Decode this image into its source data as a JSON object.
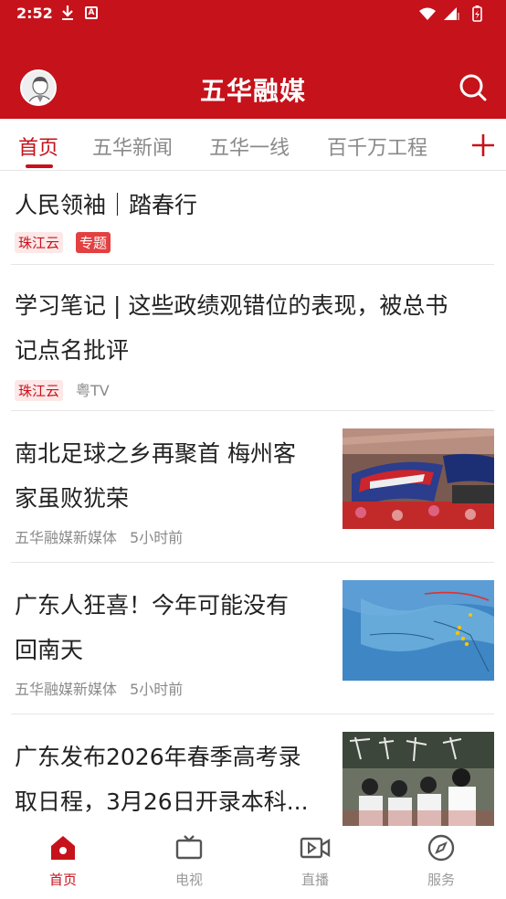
{
  "status_bar": {
    "time": "2:52",
    "download_icon": "download-icon",
    "accessibility_icon": "a-badge-icon"
  },
  "header": {
    "title": "五华融媒",
    "avatar_icon": "user-avatar-icon",
    "search_icon": "search-icon",
    "background": "#c6121b"
  },
  "tabs": [
    {
      "label": "首页",
      "active": true
    },
    {
      "label": "五华新闻"
    },
    {
      "label": "五华一线"
    },
    {
      "label": "百千万工程"
    }
  ],
  "tab_add_icon": "plus-icon",
  "feed": [
    {
      "title": "人民领袖｜踏春行",
      "tags": [
        "珠江云",
        "专题"
      ]
    },
    {
      "title_line1": "学习笔记 | 这些政绩观错位的表现，被总书",
      "title_line2": "记点名批评",
      "tag": "珠江云",
      "source": "粤TV"
    },
    {
      "title_line1": "南北足球之乡再聚首 梅州客",
      "title_line2": "家虽败犹荣",
      "source": "五华融媒新媒体",
      "time": "5小时前",
      "image": "football-crowd-photo"
    },
    {
      "title_line1": "广东人狂喜！今年可能没有",
      "title_line2": "回南天",
      "source": "五华融媒新媒体",
      "time": "5小时前",
      "image": "weather-map-photo"
    },
    {
      "title_line1": "广东发布2026年春季高考录",
      "title_line2": "取日程，3月26日开录本科...",
      "image": "classroom-photo"
    }
  ],
  "bottom_nav": [
    {
      "label": "首页",
      "icon": "home-icon",
      "active": true
    },
    {
      "label": "电视",
      "icon": "tv-icon"
    },
    {
      "label": "直播",
      "icon": "video-camera-icon"
    },
    {
      "label": "服务",
      "icon": "compass-icon"
    }
  ]
}
